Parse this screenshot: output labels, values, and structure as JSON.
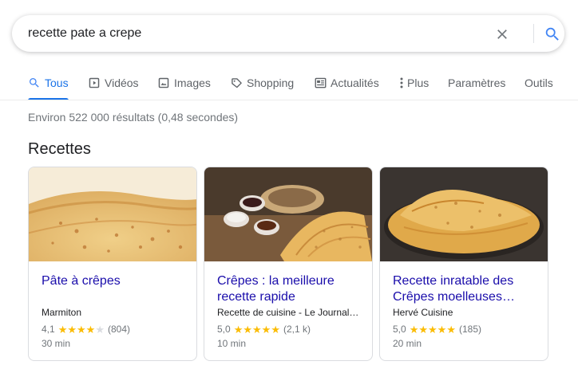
{
  "search": {
    "query": "recette pate a crepe"
  },
  "tabs": [
    {
      "label": "Tous",
      "icon": "search-icon",
      "active": true
    },
    {
      "label": "Vidéos",
      "icon": "video-icon"
    },
    {
      "label": "Images",
      "icon": "image-icon"
    },
    {
      "label": "Shopping",
      "icon": "tag-icon"
    },
    {
      "label": "Actualités",
      "icon": "newspaper-icon"
    },
    {
      "label": "Plus",
      "icon": "more-vert-icon"
    },
    {
      "label": "Paramètres"
    },
    {
      "label": "Outils"
    }
  ],
  "result_stats": "Environ 522 000 résultats (0,48 secondes)",
  "section_title": "Recettes",
  "recipes": [
    {
      "title": "Pâte à crêpes",
      "source": "Marmiton",
      "rating": "4,1",
      "rating_value": 4.1,
      "reviews": "(804)",
      "time": "30 min"
    },
    {
      "title": "Crêpes : la meilleure recette rapide",
      "source": "Recette de cuisine - Le Journal…",
      "rating": "5,0",
      "rating_value": 5.0,
      "reviews": "(2,1 k)",
      "time": "10 min"
    },
    {
      "title": "Recette inratable des Crêpes moelleuses…",
      "source": "Hervé Cuisine",
      "rating": "5,0",
      "rating_value": 5.0,
      "reviews": "(185)",
      "time": "20 min"
    }
  ],
  "colors": {
    "accent": "#1a73e8",
    "link": "#1a0dab",
    "star": "#fbbc04"
  }
}
